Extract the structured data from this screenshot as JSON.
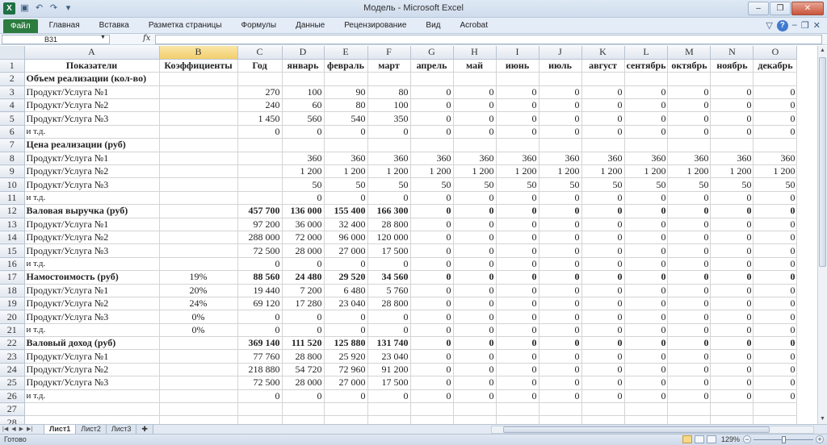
{
  "window": {
    "title": "Модель - Microsoft Excel",
    "logo": "X",
    "buttons": [
      "–",
      "❐",
      "✕"
    ]
  },
  "ribbon": {
    "file_tab": "Файл",
    "tabs": [
      "Главная",
      "Вставка",
      "Разметка страницы",
      "Формулы",
      "Данные",
      "Рецензирование",
      "Вид",
      "Acrobat"
    ],
    "right_icons": [
      "▽",
      "?",
      "–",
      "❐",
      "✕"
    ]
  },
  "formula_bar": {
    "name_box": "B31",
    "fx_label": "fx",
    "formula": ""
  },
  "grid": {
    "columns": [
      "A",
      "B",
      "C",
      "D",
      "E",
      "F",
      "G",
      "H",
      "I",
      "J",
      "K",
      "L",
      "M",
      "N",
      "O"
    ],
    "selected_column": "B",
    "rows": [
      {
        "n": "1",
        "type": "header",
        "cells": [
          "Показатели",
          "Коэффициенты",
          "Год",
          "январь",
          "февраль",
          "март",
          "апрель",
          "май",
          "июнь",
          "июль",
          "август",
          "сентябрь",
          "октябрь",
          "ноябрь",
          "декабрь"
        ]
      },
      {
        "n": "2",
        "type": "section",
        "cells": [
          "Объем реализации (кол-во)",
          "",
          "",
          "",
          "",
          "",
          "",
          "",
          "",
          "",
          "",
          "",
          "",
          "",
          ""
        ]
      },
      {
        "n": "3",
        "type": "item",
        "cells": [
          "Продукт/Услуга №1",
          "",
          "270",
          "100",
          "90",
          "80",
          "0",
          "0",
          "0",
          "0",
          "0",
          "0",
          "0",
          "0",
          "0"
        ]
      },
      {
        "n": "4",
        "type": "item",
        "cells": [
          "Продукт/Услуга №2",
          "",
          "240",
          "60",
          "80",
          "100",
          "0",
          "0",
          "0",
          "0",
          "0",
          "0",
          "0",
          "0",
          "0"
        ]
      },
      {
        "n": "5",
        "type": "item",
        "cells": [
          "Продукт/Услуга №3",
          "",
          "1 450",
          "560",
          "540",
          "350",
          "0",
          "0",
          "0",
          "0",
          "0",
          "0",
          "0",
          "0",
          "0"
        ]
      },
      {
        "n": "6",
        "type": "itd",
        "cells": [
          "и т.д.",
          "",
          "0",
          "0",
          "0",
          "0",
          "0",
          "0",
          "0",
          "0",
          "0",
          "0",
          "0",
          "0",
          "0"
        ]
      },
      {
        "n": "7",
        "type": "section",
        "cells": [
          "Цена реализации (руб)",
          "",
          "",
          "",
          "",
          "",
          "",
          "",
          "",
          "",
          "",
          "",
          "",
          "",
          ""
        ]
      },
      {
        "n": "8",
        "type": "item",
        "cells": [
          "Продукт/Услуга №1",
          "",
          "",
          "360",
          "360",
          "360",
          "360",
          "360",
          "360",
          "360",
          "360",
          "360",
          "360",
          "360",
          "360"
        ]
      },
      {
        "n": "9",
        "type": "item",
        "cells": [
          "Продукт/Услуга №2",
          "",
          "",
          "1 200",
          "1 200",
          "1 200",
          "1 200",
          "1 200",
          "1 200",
          "1 200",
          "1 200",
          "1 200",
          "1 200",
          "1 200",
          "1 200"
        ]
      },
      {
        "n": "10",
        "type": "item",
        "cells": [
          "Продукт/Услуга №3",
          "",
          "",
          "50",
          "50",
          "50",
          "50",
          "50",
          "50",
          "50",
          "50",
          "50",
          "50",
          "50",
          "50"
        ]
      },
      {
        "n": "11",
        "type": "itd",
        "cells": [
          "и т.д.",
          "",
          "",
          "0",
          "0",
          "0",
          "0",
          "0",
          "0",
          "0",
          "0",
          "0",
          "0",
          "0",
          "0"
        ]
      },
      {
        "n": "12",
        "type": "total",
        "cells": [
          "Валовая выручка (руб)",
          "",
          "457 700",
          "136 000",
          "155 400",
          "166 300",
          "0",
          "0",
          "0",
          "0",
          "0",
          "0",
          "0",
          "0",
          "0"
        ]
      },
      {
        "n": "13",
        "type": "item",
        "cells": [
          "Продукт/Услуга №1",
          "",
          "97 200",
          "36 000",
          "32 400",
          "28 800",
          "0",
          "0",
          "0",
          "0",
          "0",
          "0",
          "0",
          "0",
          "0"
        ]
      },
      {
        "n": "14",
        "type": "item",
        "cells": [
          "Продукт/Услуга №2",
          "",
          "288 000",
          "72 000",
          "96 000",
          "120 000",
          "0",
          "0",
          "0",
          "0",
          "0",
          "0",
          "0",
          "0",
          "0"
        ]
      },
      {
        "n": "15",
        "type": "item",
        "cells": [
          "Продукт/Услуга №3",
          "",
          "72 500",
          "28 000",
          "27 000",
          "17 500",
          "0",
          "0",
          "0",
          "0",
          "0",
          "0",
          "0",
          "0",
          "0"
        ]
      },
      {
        "n": "16",
        "type": "itd",
        "cells": [
          "и т.д.",
          "",
          "0",
          "0",
          "0",
          "0",
          "0",
          "0",
          "0",
          "0",
          "0",
          "0",
          "0",
          "0",
          "0"
        ]
      },
      {
        "n": "17",
        "type": "total",
        "cells": [
          "Намостоимость (руб)",
          "19%",
          "88 560",
          "24 480",
          "29 520",
          "34 560",
          "0",
          "0",
          "0",
          "0",
          "0",
          "0",
          "0",
          "0",
          "0"
        ]
      },
      {
        "n": "18",
        "type": "item",
        "cells": [
          "Продукт/Услуга №1",
          "20%",
          "19 440",
          "7 200",
          "6 480",
          "5 760",
          "0",
          "0",
          "0",
          "0",
          "0",
          "0",
          "0",
          "0",
          "0"
        ]
      },
      {
        "n": "19",
        "type": "item",
        "cells": [
          "Продукт/Услуга №2",
          "24%",
          "69 120",
          "17 280",
          "23 040",
          "28 800",
          "0",
          "0",
          "0",
          "0",
          "0",
          "0",
          "0",
          "0",
          "0"
        ]
      },
      {
        "n": "20",
        "type": "item",
        "cells": [
          "Продукт/Услуга №3",
          "0%",
          "0",
          "0",
          "0",
          "0",
          "0",
          "0",
          "0",
          "0",
          "0",
          "0",
          "0",
          "0",
          "0"
        ]
      },
      {
        "n": "21",
        "type": "itd",
        "cells": [
          "и т.д.",
          "0%",
          "0",
          "0",
          "0",
          "0",
          "0",
          "0",
          "0",
          "0",
          "0",
          "0",
          "0",
          "0",
          "0"
        ]
      },
      {
        "n": "22",
        "type": "total",
        "cells": [
          "Валовый доход (руб)",
          "",
          "369 140",
          "111 520",
          "125 880",
          "131 740",
          "0",
          "0",
          "0",
          "0",
          "0",
          "0",
          "0",
          "0",
          "0"
        ]
      },
      {
        "n": "23",
        "type": "item",
        "cells": [
          "Продукт/Услуга №1",
          "",
          "77 760",
          "28 800",
          "25 920",
          "23 040",
          "0",
          "0",
          "0",
          "0",
          "0",
          "0",
          "0",
          "0",
          "0"
        ]
      },
      {
        "n": "24",
        "type": "item",
        "cells": [
          "Продукт/Услуга №2",
          "",
          "218 880",
          "54 720",
          "72 960",
          "91 200",
          "0",
          "0",
          "0",
          "0",
          "0",
          "0",
          "0",
          "0",
          "0"
        ]
      },
      {
        "n": "25",
        "type": "item",
        "cells": [
          "Продукт/Услуга №3",
          "",
          "72 500",
          "28 000",
          "27 000",
          "17 500",
          "0",
          "0",
          "0",
          "0",
          "0",
          "0",
          "0",
          "0",
          "0"
        ]
      },
      {
        "n": "26",
        "type": "itd",
        "cells": [
          "и т.д.",
          "",
          "0",
          "0",
          "0",
          "0",
          "0",
          "0",
          "0",
          "0",
          "0",
          "0",
          "0",
          "0",
          "0"
        ]
      },
      {
        "n": "27",
        "type": "empty",
        "cells": [
          "",
          "",
          "",
          "",
          "",
          "",
          "",
          "",
          "",
          "",
          "",
          "",
          "",
          "",
          ""
        ]
      },
      {
        "n": "28",
        "type": "empty",
        "cells": [
          "",
          "",
          "",
          "",
          "",
          "",
          "",
          "",
          "",
          "",
          "",
          "",
          "",
          "",
          ""
        ]
      }
    ]
  },
  "sheets": {
    "tabs": [
      "Лист1",
      "Лист2",
      "Лист3"
    ],
    "active": "Лист1"
  },
  "status": {
    "text": "Готово",
    "zoom": "129%"
  }
}
